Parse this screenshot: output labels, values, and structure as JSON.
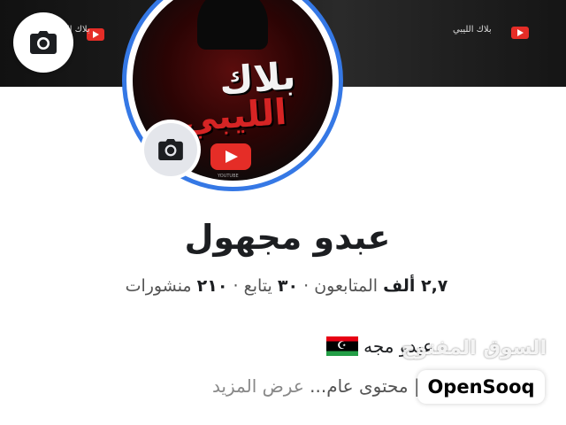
{
  "cover": {
    "text_right": "بلاك الليبي",
    "text_left": "بلاك الليبي",
    "edit_cover_icon": "camera-icon"
  },
  "avatar": {
    "line1": "بلاك",
    "line2": "الليبي",
    "caption": "YOUTUBE",
    "edit_icon": "camera-icon",
    "ring_color": "#3578e5"
  },
  "profile": {
    "name": "عبدو مجهول",
    "stats": {
      "followers_count": "٢,٧ ألف",
      "followers_label": "المتابعون",
      "following_count": "٣٠",
      "following_label": "يتابع",
      "posts_count": "٢١٠",
      "posts_label": "منشورات",
      "separator": "·"
    },
    "bio_line1": "عبدو مجه",
    "bio_line2": "ع محتوى | محتوى عام...",
    "see_more": "عرض المزيد"
  },
  "watermark": {
    "arabic": "السوق المفتوح",
    "brand": "OpenSooq"
  }
}
